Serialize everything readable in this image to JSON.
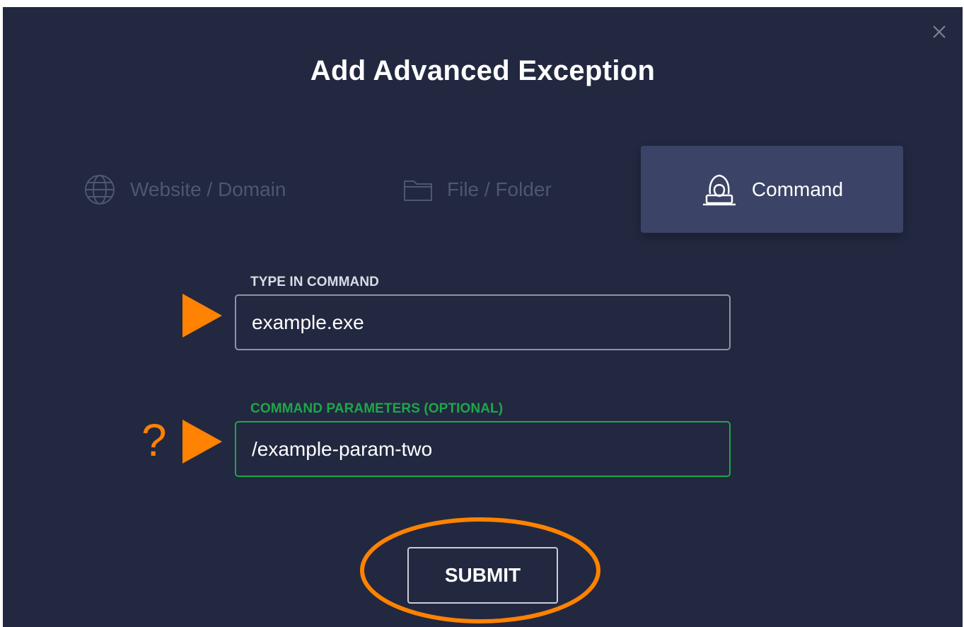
{
  "dialog": {
    "title": "Add Advanced Exception",
    "close_icon": "close-icon"
  },
  "tabs": [
    {
      "label": "Website / Domain",
      "icon": "globe-icon",
      "selected": false
    },
    {
      "label": "File / Folder",
      "icon": "folder-icon",
      "selected": false
    },
    {
      "label": "Command",
      "icon": "hacker-icon",
      "selected": true
    }
  ],
  "form": {
    "command": {
      "label": "TYPE IN COMMAND",
      "value": "example.exe"
    },
    "parameters": {
      "label": "COMMAND PARAMETERS (OPTIONAL)",
      "value": "/example-param-two"
    },
    "submit_label": "SUBMIT"
  },
  "annotations": {
    "question_mark": "?",
    "arrow_color": "#ff8200",
    "ring_color": "#ff8200"
  },
  "colors": {
    "background": "#222840",
    "selected_tab": "#3b4466",
    "focus_green": "#1fa64a",
    "accent_orange": "#ff8200"
  }
}
